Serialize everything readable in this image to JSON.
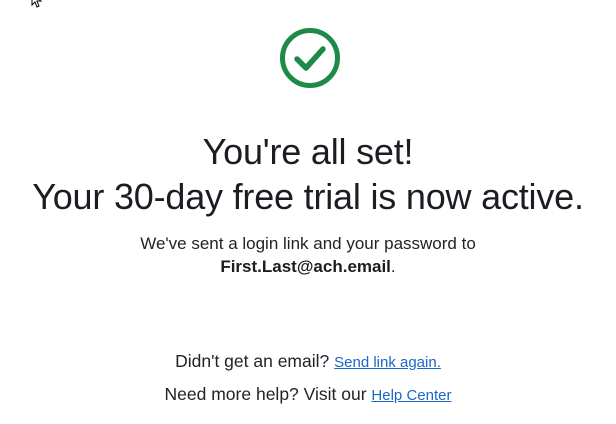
{
  "colors": {
    "success_green": "#1e8a4a",
    "link_blue": "#1a66c9",
    "text": "#1f1f24"
  },
  "icons": {
    "status": "check-circle-icon",
    "pointer": "mouse-cursor-icon"
  },
  "confirmation": {
    "title": "You're all set!",
    "subtitle": "Your 30-day free trial is now active.",
    "sent_text": "We've sent a login link and your password to",
    "email": "First.Last@ach.email",
    "email_suffix": "."
  },
  "help": {
    "resend_prompt": "Didn't get an email?",
    "resend_link": "Send link again.",
    "help_prompt": "Need more help? Visit our",
    "help_link": "Help Center"
  }
}
